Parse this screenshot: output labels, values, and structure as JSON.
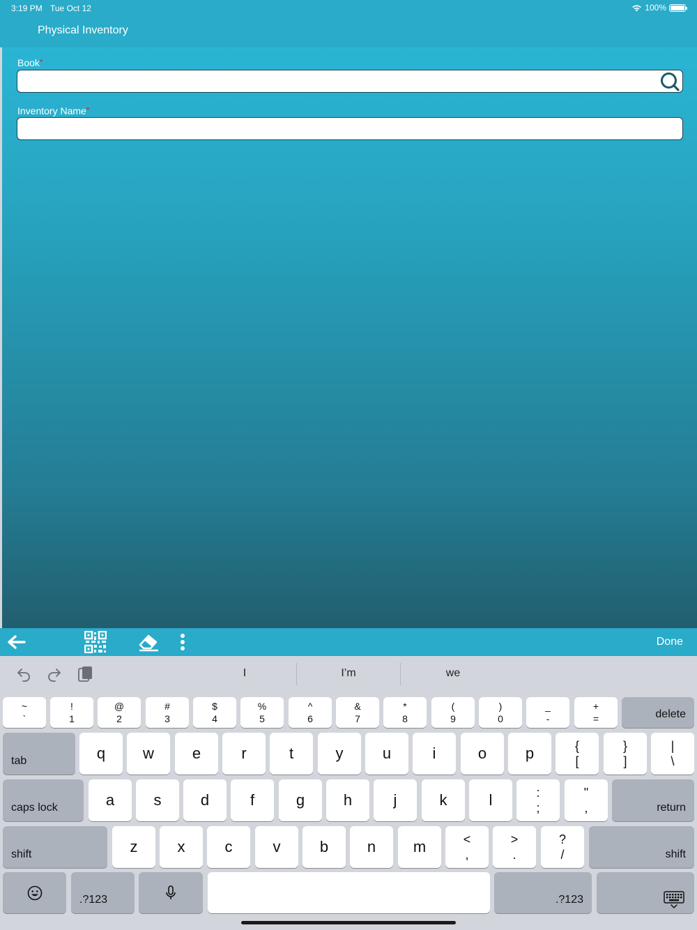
{
  "status": {
    "time": "3:19 PM",
    "date": "Tue Oct 12",
    "battery": "100%"
  },
  "nav": {
    "title": "Physical Inventory"
  },
  "form": {
    "book_label": "Book",
    "book_value": "",
    "name_label": "Inventory Name",
    "name_value": "",
    "required_mark": "*"
  },
  "toolbar": {
    "icons": [
      "back-arrow-icon",
      "qr-code-icon",
      "eraser-icon",
      "more-vertical-icon"
    ],
    "done_label": "Done"
  },
  "keyboard": {
    "suggestions": [
      "I",
      "I’m",
      "we"
    ],
    "number_row": [
      {
        "top": "~",
        "bottom": "`"
      },
      {
        "top": "!",
        "bottom": "1"
      },
      {
        "top": "@",
        "bottom": "2"
      },
      {
        "top": "#",
        "bottom": "3"
      },
      {
        "top": "$",
        "bottom": "4"
      },
      {
        "top": "%",
        "bottom": "5"
      },
      {
        "top": "^",
        "bottom": "6"
      },
      {
        "top": "&",
        "bottom": "7"
      },
      {
        "top": "*",
        "bottom": "8"
      },
      {
        "top": "(",
        "bottom": "9"
      },
      {
        "top": ")",
        "bottom": "0"
      },
      {
        "top": "_",
        "bottom": "-"
      },
      {
        "top": "+",
        "bottom": "="
      }
    ],
    "delete_label": "delete",
    "tab_label": "tab",
    "row_q": [
      "q",
      "w",
      "e",
      "r",
      "t",
      "y",
      "u",
      "i",
      "o",
      "p"
    ],
    "row_q_extra": [
      {
        "top": "{",
        "bottom": "["
      },
      {
        "top": "}",
        "bottom": "]"
      },
      {
        "top": "|",
        "bottom": "\\"
      }
    ],
    "caps_label": "caps lock",
    "row_a": [
      "a",
      "s",
      "d",
      "f",
      "g",
      "h",
      "j",
      "k",
      "l"
    ],
    "row_a_extra": [
      {
        "top": ":",
        "bottom": ";"
      },
      {
        "top": "\"",
        "bottom": ","
      }
    ],
    "return_label": "return",
    "shift_label": "shift",
    "row_z": [
      "z",
      "x",
      "c",
      "v",
      "b",
      "n",
      "m"
    ],
    "row_z_extra": [
      {
        "top": "<",
        "bottom": ","
      },
      {
        "top": ">",
        "bottom": "."
      },
      {
        "top": "?",
        "bottom": "/"
      }
    ],
    "numbers_label": ".?123"
  },
  "colors": {
    "bar": "#29abc9",
    "required": "#e02020",
    "gradient_top": "#2ab5d4",
    "gradient_bottom": "#225e6f"
  }
}
